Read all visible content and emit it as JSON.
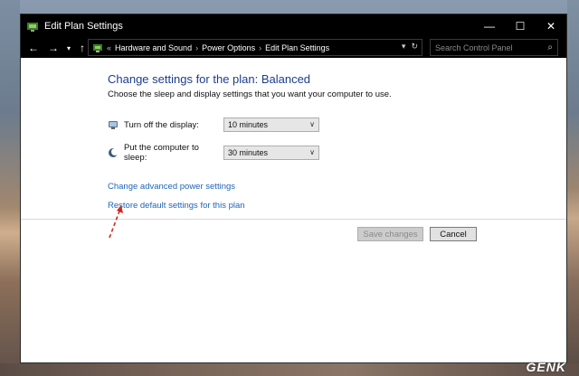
{
  "window": {
    "title": "Edit Plan Settings",
    "controls": {
      "minimize": "—",
      "maximize": "☐",
      "close": "✕"
    }
  },
  "nav": {
    "back": "←",
    "forward": "→",
    "recent": "▾",
    "up": "↑"
  },
  "breadcrumb": {
    "overflow": "«",
    "items": [
      "Hardware and Sound",
      "Power Options",
      "Edit Plan Settings"
    ],
    "separator": "›",
    "refresh": "↻",
    "dropdown": "▾"
  },
  "search": {
    "placeholder": "Search Control Panel"
  },
  "main": {
    "heading": "Change settings for the plan: Balanced",
    "subtext": "Choose the sleep and display settings that you want your computer to use.",
    "settings": [
      {
        "label": "Turn off the display:",
        "value": "10 minutes",
        "icon": "monitor-icon"
      },
      {
        "label": "Put the computer to sleep:",
        "value": "30 minutes",
        "icon": "moon-icon"
      }
    ],
    "links": {
      "advanced": "Change advanced power settings",
      "restore": "Restore default settings for this plan"
    },
    "buttons": {
      "save": "Save changes",
      "cancel": "Cancel"
    }
  },
  "watermark": "GENK",
  "colors": {
    "heading": "#1c3d8c",
    "link": "#1e64b7",
    "titlebar": "#000000",
    "annotation_arrow": "#d0261f"
  }
}
